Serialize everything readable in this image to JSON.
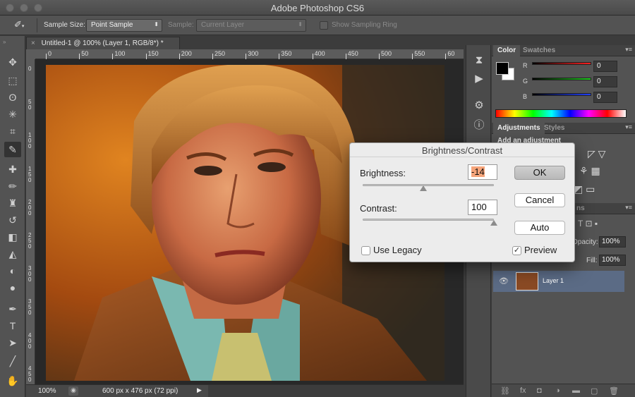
{
  "window": {
    "title": "Adobe Photoshop CS6"
  },
  "options_bar": {
    "sample_size_label": "Sample Size:",
    "sample_size_value": "Point Sample",
    "sample_label": "Sample:",
    "sample_value": "Current Layer",
    "show_ring_label": "Show Sampling Ring"
  },
  "document": {
    "tab_title": "Untitled-1 @ 100% (Layer 1, RGB/8*) *",
    "ruler_h": [
      "0",
      "50",
      "100",
      "150",
      "200",
      "250",
      "300",
      "350",
      "400",
      "450",
      "500",
      "550",
      "60"
    ],
    "ruler_v": [
      "0",
      "5\n0",
      "1\n0\n0",
      "1\n5\n0",
      "2\n0\n0",
      "2\n5\n0",
      "3\n0\n0",
      "3\n5\n0",
      "4\n0\n0",
      "4\n5\n0"
    ],
    "zoom": "100%",
    "doc_info": "600 px x 476 px (72 ppi)"
  },
  "color_panel": {
    "tabs": [
      "Color",
      "Swatches"
    ],
    "r_label": "R",
    "r_value": "0",
    "g_label": "G",
    "g_value": "0",
    "b_label": "B",
    "b_value": "0",
    "colors": {
      "r": "#ff2020",
      "g": "#20d020",
      "b": "#2040ff"
    }
  },
  "adjustments_panel": {
    "tabs": [
      "Adjustments",
      "Styles"
    ],
    "hint": "Add an adjustment"
  },
  "layers_panel": {
    "partial_tab": "ns",
    "opacity_label": "Opacity:",
    "opacity_value": "100%",
    "fill_label": "Fill:",
    "fill_value": "100%",
    "layer_name": "Layer 1"
  },
  "dialog": {
    "title": "Brightness/Contrast",
    "brightness_label": "Brightness:",
    "brightness_value": "-14",
    "brightness_fraction": 0.465,
    "contrast_label": "Contrast:",
    "contrast_value": "100",
    "contrast_fraction": 1.0,
    "ok_label": "OK",
    "cancel_label": "Cancel",
    "auto_label": "Auto",
    "legacy_label": "Use Legacy",
    "legacy_checked": false,
    "preview_label": "Preview",
    "preview_checked": true
  }
}
